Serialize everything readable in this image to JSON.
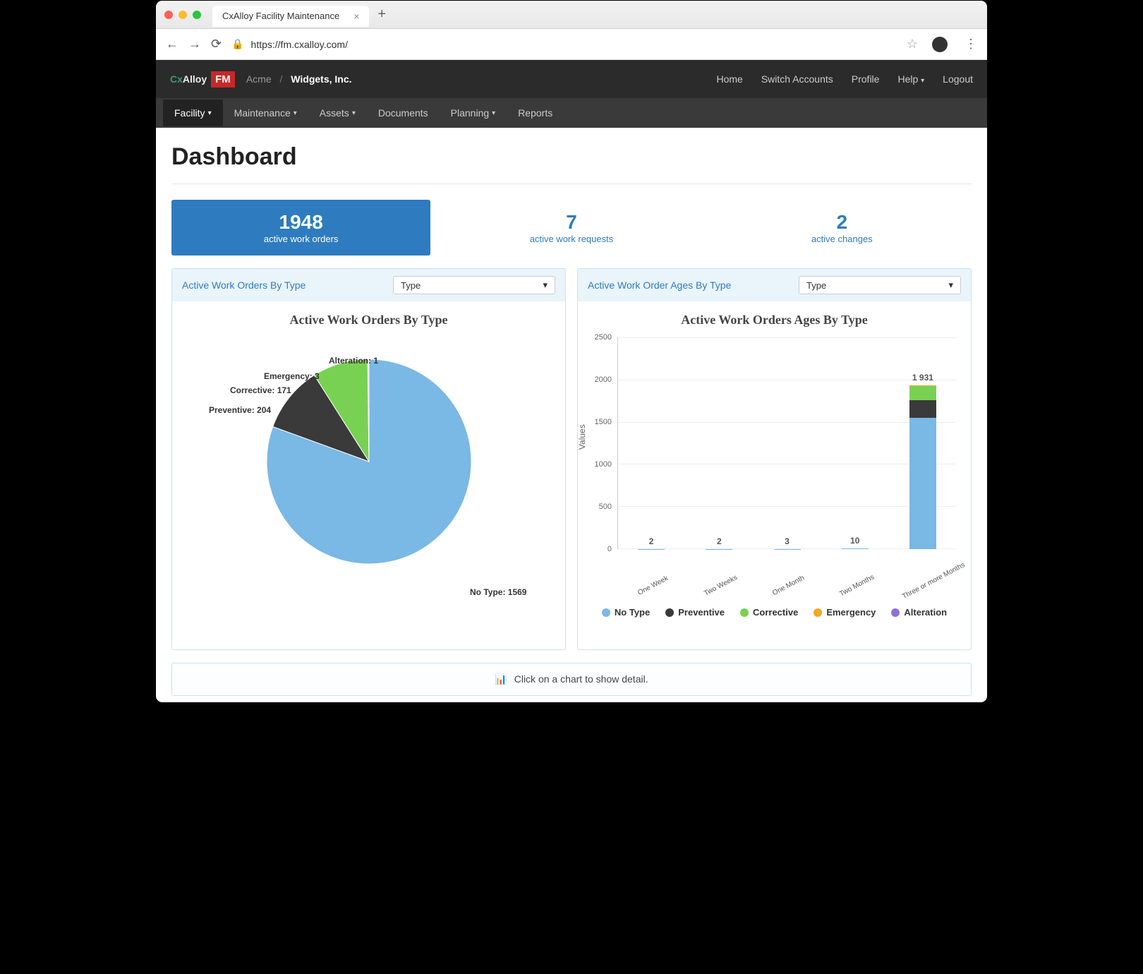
{
  "browser": {
    "tab_title": "CxAlloy Facility Maintenance",
    "url": "https://fm.cxalloy.com/"
  },
  "header": {
    "breadcrumb_a": "Acme",
    "breadcrumb_b": "Widgets, Inc.",
    "links": [
      "Home",
      "Switch Accounts",
      "Profile",
      "Help",
      "Logout"
    ]
  },
  "nav": {
    "items": [
      {
        "label": "Facility",
        "caret": true,
        "active": true
      },
      {
        "label": "Maintenance",
        "caret": true
      },
      {
        "label": "Assets",
        "caret": true
      },
      {
        "label": "Documents",
        "caret": false
      },
      {
        "label": "Planning",
        "caret": true
      },
      {
        "label": "Reports",
        "caret": false
      }
    ]
  },
  "page": {
    "title": "Dashboard",
    "cards": [
      {
        "value": "1948",
        "label": "active work orders",
        "primary": true
      },
      {
        "value": "7",
        "label": "active work requests",
        "primary": false
      },
      {
        "value": "2",
        "label": "active changes",
        "primary": false
      }
    ],
    "panel_a_title": "Active Work Orders By Type",
    "panel_a_select": "Type",
    "panel_b_title": "Active Work Order Ages By Type",
    "panel_b_select": "Type",
    "hint": "Click on a chart to show detail."
  },
  "colors": {
    "no_type": "#7ab8e6",
    "preventive": "#3a3a3a",
    "corrective": "#79d154",
    "emergency": "#f5a623",
    "alteration": "#8e6fd9"
  },
  "chart_data": [
    {
      "id": "pie",
      "type": "pie",
      "title": "Active Work Orders By Type",
      "series": [
        {
          "name": "No Type",
          "value": 1569,
          "color": "#7ab8e6"
        },
        {
          "name": "Preventive",
          "value": 204,
          "color": "#3a3a3a"
        },
        {
          "name": "Corrective",
          "value": 171,
          "color": "#79d154"
        },
        {
          "name": "Emergency",
          "value": 3,
          "color": "#f5a623"
        },
        {
          "name": "Alteration",
          "value": 1,
          "color": "#8e6fd9"
        }
      ],
      "total": 1948
    },
    {
      "id": "bars",
      "type": "bar",
      "title": "Active Work Orders Ages By Type",
      "ylabel": "Values",
      "ylim": [
        0,
        2500
      ],
      "y_ticks": [
        0,
        500,
        1000,
        1500,
        2000,
        2500
      ],
      "categories": [
        "One Week",
        "Two Weeks",
        "One Month",
        "Two Months",
        "Three or more Months"
      ],
      "totals": [
        2,
        2,
        3,
        10,
        1931
      ],
      "series": [
        {
          "name": "No Type",
          "color": "#7ab8e6",
          "values": [
            2,
            2,
            3,
            10,
            1552
          ]
        },
        {
          "name": "Preventive",
          "color": "#3a3a3a",
          "values": [
            0,
            0,
            0,
            0,
            204
          ]
        },
        {
          "name": "Corrective",
          "color": "#79d154",
          "values": [
            0,
            0,
            0,
            0,
            171
          ]
        },
        {
          "name": "Emergency",
          "color": "#f5a623",
          "values": [
            0,
            0,
            0,
            0,
            3
          ]
        },
        {
          "name": "Alteration",
          "color": "#8e6fd9",
          "values": [
            0,
            0,
            0,
            0,
            1
          ]
        }
      ],
      "legend": [
        "No Type",
        "Preventive",
        "Corrective",
        "Emergency",
        "Alteration"
      ]
    }
  ]
}
